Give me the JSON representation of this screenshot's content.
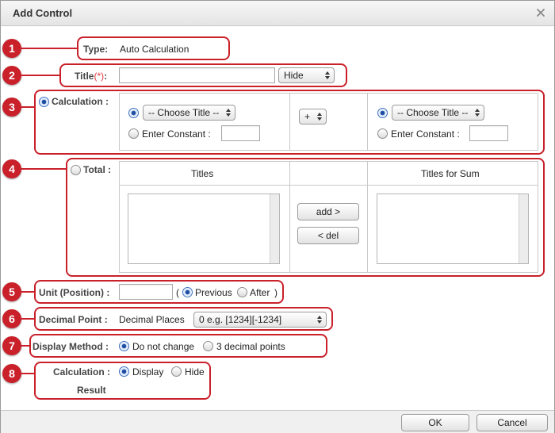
{
  "dialog": {
    "title": "Add Control"
  },
  "type": {
    "label": "Type",
    "colon": ":",
    "value": "Auto Calculation"
  },
  "title_field": {
    "label": "Title",
    "required": "(*)",
    "colon": ":",
    "value": "",
    "visibility": "Hide"
  },
  "calculation": {
    "label": "Calculation",
    "colon": ":",
    "left": {
      "choose_title": "-- Choose Title --",
      "enter_constant": "Enter Constant",
      "colon": ":"
    },
    "operator": "+",
    "right": {
      "choose_title": "-- Choose Title --",
      "enter_constant": "Enter Constant",
      "colon": ":"
    }
  },
  "total": {
    "label": "Total",
    "colon": ":",
    "titles_header": "Titles",
    "sum_header": "Titles for Sum",
    "add_button": "add >",
    "del_button": "< del"
  },
  "unit": {
    "label": "Unit (Position)",
    "colon": ":",
    "open_paren": "(",
    "previous": "Previous",
    "after": "After",
    "close_paren": ")"
  },
  "decimal": {
    "label": "Decimal Point",
    "colon": ":",
    "places_label": "Decimal Places",
    "selected": "0 e.g. [1234][-1234]"
  },
  "display_method": {
    "label": "Display Method",
    "colon": ":",
    "opt1": "Do not change",
    "opt2": "3 decimal points"
  },
  "calc_result": {
    "label1": "Calculation",
    "label2": "Result",
    "colon": ":",
    "display": "Display",
    "hide": "Hide"
  },
  "callouts": [
    "1",
    "2",
    "3",
    "4",
    "5",
    "6",
    "7",
    "8"
  ],
  "footer": {
    "ok": "OK",
    "cancel": "Cancel"
  },
  "colors": {
    "callout": "#c9202a",
    "required": "#e0383e",
    "radio_selected": "#1f4fa3"
  }
}
